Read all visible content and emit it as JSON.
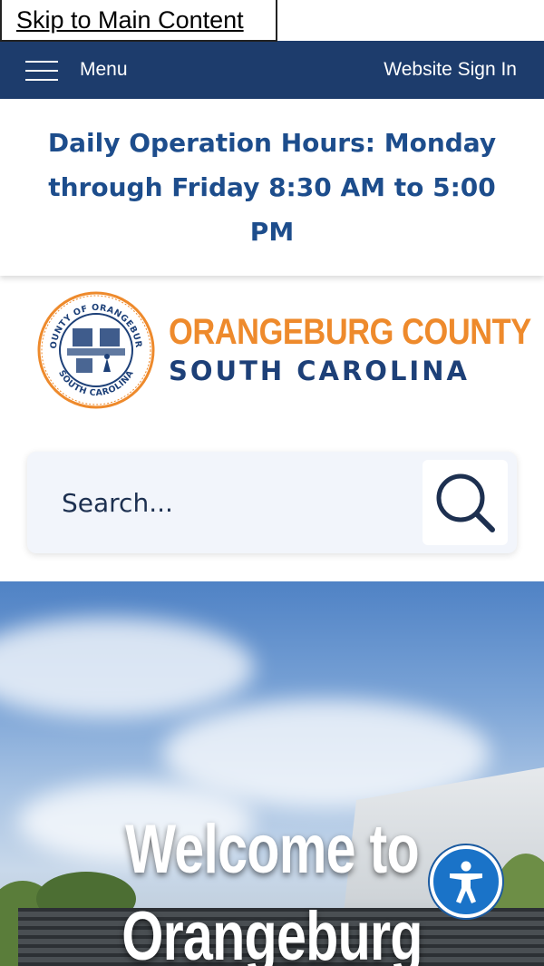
{
  "skip_link": "Skip to Main Content",
  "topbar": {
    "menu_label": "Menu",
    "menu_icon": "hamburger-icon",
    "signin_label": "Website Sign In",
    "background": "#1d3c6c"
  },
  "alert": {
    "hours_text": "Daily Operation Hours: Monday through Friday 8:30 AM to 5:00 PM",
    "color": "#1d4d8c"
  },
  "logo": {
    "line1": "ORANGEBURG COUNTY",
    "line2": "SOUTH CAROLINA",
    "seal_top_text": "COUNTY OF ORANGEBURG",
    "seal_bottom_text": "SOUTH CAROLINA",
    "accent": "#ee8a2c",
    "navy": "#1d4078"
  },
  "search": {
    "placeholder": "Search...",
    "button_icon": "search-icon"
  },
  "hero": {
    "title": "Welcome to Orangeburg"
  },
  "accessibility": {
    "icon": "accessibility-icon",
    "color": "#1a73c8"
  }
}
